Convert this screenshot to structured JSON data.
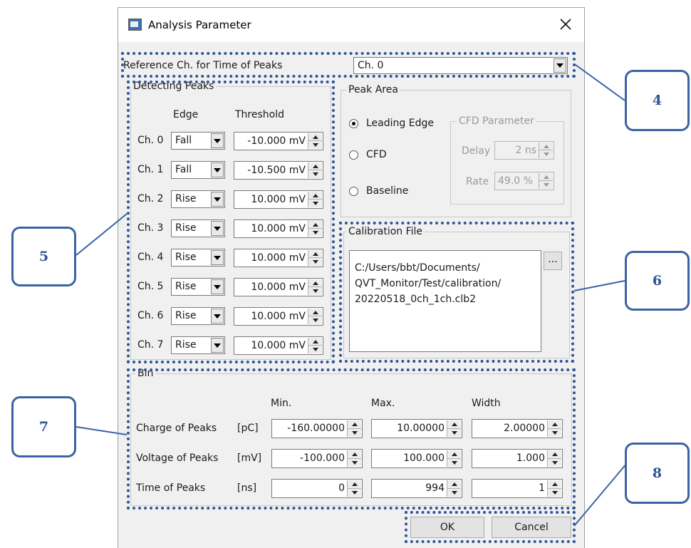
{
  "window": {
    "title": "Analysis Parameter",
    "icon": "app-window-icon",
    "close_icon": "close-icon"
  },
  "reference": {
    "label": "Reference Ch. for Time of Peaks",
    "value": "Ch. 0"
  },
  "detecting": {
    "legend": "Detecting Peaks",
    "col_edge": "Edge",
    "col_threshold": "Threshold",
    "rows": [
      {
        "ch": "Ch. 0",
        "edge": "Fall",
        "threshold": "-10.000 mV"
      },
      {
        "ch": "Ch. 1",
        "edge": "Fall",
        "threshold": "-10.500 mV"
      },
      {
        "ch": "Ch. 2",
        "edge": "Rise",
        "threshold": "10.000 mV"
      },
      {
        "ch": "Ch. 3",
        "edge": "Rise",
        "threshold": "10.000 mV"
      },
      {
        "ch": "Ch. 4",
        "edge": "Rise",
        "threshold": "10.000 mV"
      },
      {
        "ch": "Ch. 5",
        "edge": "Rise",
        "threshold": "10.000 mV"
      },
      {
        "ch": "Ch. 6",
        "edge": "Rise",
        "threshold": "10.000 mV"
      },
      {
        "ch": "Ch. 7",
        "edge": "Rise",
        "threshold": "10.000 mV"
      }
    ]
  },
  "peak_area": {
    "legend": "Peak Area",
    "options": [
      "Leading Edge",
      "CFD",
      "Baseline"
    ],
    "selected": "Leading Edge",
    "cfd": {
      "legend": "CFD Parameter",
      "delay_label": "Delay",
      "delay_value": "2 ns",
      "rate_label": "Rate",
      "rate_value": "49.0 %"
    }
  },
  "calibration": {
    "legend": "Calibration File",
    "path_lines": [
      "C:/Users/bbt/Documents/",
      "QVT_Monitor/Test/calibration/",
      "20220518_0ch_1ch.clb2"
    ],
    "browse_label": "..."
  },
  "bin": {
    "legend": "Bin",
    "col_min": "Min.",
    "col_max": "Max.",
    "col_width": "Width",
    "rows": [
      {
        "label": "Charge of Peaks",
        "unit": "[pC]",
        "min": "-160.00000",
        "max": "10.00000",
        "width": "2.00000"
      },
      {
        "label": "Voltage of Peaks",
        "unit": "[mV]",
        "min": "-100.000",
        "max": "100.000",
        "width": "1.000"
      },
      {
        "label": "Time of Peaks",
        "unit": "[ns]",
        "min": "0",
        "max": "994",
        "width": "1"
      }
    ]
  },
  "buttons": {
    "ok": "OK",
    "cancel": "Cancel"
  },
  "callouts": [
    "4",
    "5",
    "6",
    "7",
    "8"
  ],
  "colors": {
    "accent": "#2f5597",
    "dialog_bg": "#f0f0f0",
    "border": "#a0a0a0"
  }
}
